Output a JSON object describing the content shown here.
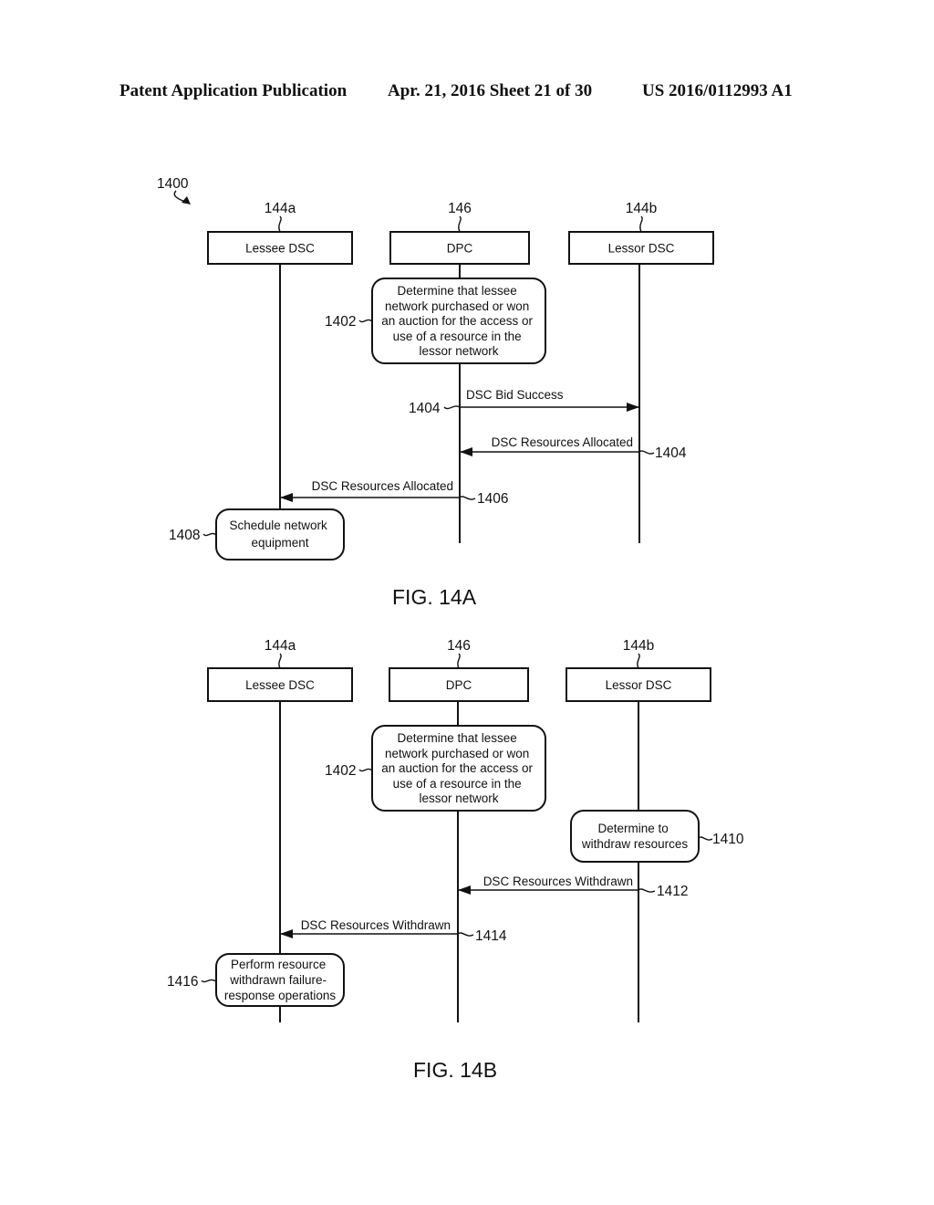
{
  "header": {
    "publication": "Patent Application Publication",
    "date_sheet": "Apr. 21, 2016  Sheet 21 of 30",
    "patent_number": "US 2016/0112993 A1"
  },
  "diagram_ref": "1400",
  "fig_a": {
    "caption": "FIG. 14A",
    "participants": [
      {
        "ref": "144a",
        "label": "Lessee DSC"
      },
      {
        "ref": "146",
        "label": "DPC"
      },
      {
        "ref": "144b",
        "label": "Lessor DSC"
      }
    ],
    "steps": [
      {
        "ref": "1402",
        "lines": [
          "Determine that lessee",
          "network purchased or won",
          "an auction for the access or",
          "use of a resource in the",
          "lessor network"
        ]
      },
      {
        "ref": "1408",
        "lines": [
          "Schedule network",
          "equipment"
        ]
      }
    ],
    "messages": [
      {
        "ref": "1404",
        "label": "DSC Bid Success",
        "from": "DPC",
        "to": "Lessor DSC"
      },
      {
        "ref": "1404",
        "label": "DSC Resources Allocated",
        "from": "Lessor DSC",
        "to": "DPC"
      },
      {
        "ref": "1406",
        "label": "DSC Resources Allocated",
        "from": "DPC",
        "to": "Lessee DSC"
      }
    ]
  },
  "fig_b": {
    "caption": "FIG. 14B",
    "participants": [
      {
        "ref": "144a",
        "label": "Lessee DSC"
      },
      {
        "ref": "146",
        "label": "DPC"
      },
      {
        "ref": "144b",
        "label": "Lessor DSC"
      }
    ],
    "steps": [
      {
        "ref": "1402",
        "lines": [
          "Determine that lessee",
          "network purchased or won",
          "an auction for the access or",
          "use of a resource in the",
          "lessor network"
        ]
      },
      {
        "ref": "1410",
        "lines": [
          "Determine to",
          "withdraw resources"
        ]
      },
      {
        "ref": "1416",
        "lines": [
          "Perform resource",
          "withdrawn failure-",
          "response operations"
        ]
      }
    ],
    "messages": [
      {
        "ref": "1412",
        "label": "DSC Resources Withdrawn",
        "from": "Lessor DSC",
        "to": "DPC"
      },
      {
        "ref": "1414",
        "label": "DSC Resources Withdrawn",
        "from": "DPC",
        "to": "Lessee DSC"
      }
    ]
  }
}
